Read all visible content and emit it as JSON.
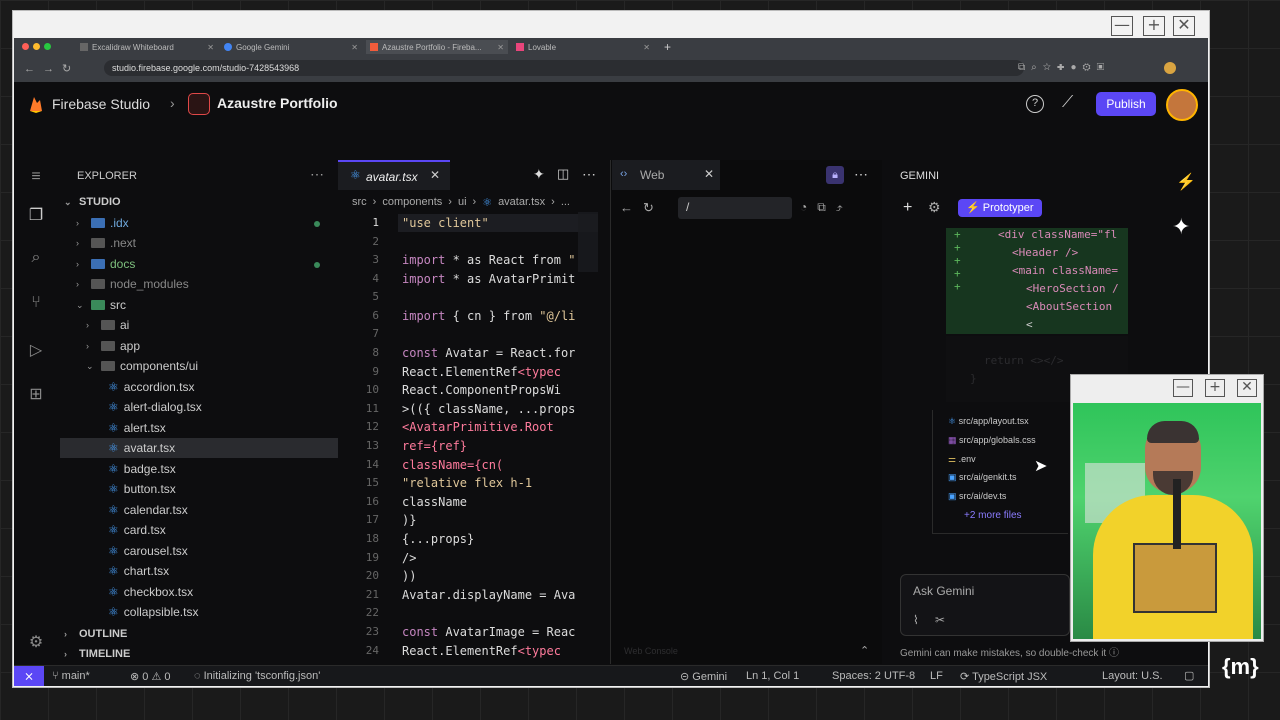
{
  "window_controls": {
    "minimize": "—",
    "maximize": "+",
    "close": "✕"
  },
  "browser": {
    "tabs": [
      {
        "label": "Excalidraw Whiteboard"
      },
      {
        "label": "Google Gemini"
      },
      {
        "label": "Azaustre Portfolio - Fireba..."
      },
      {
        "label": "Lovable"
      }
    ],
    "new_tab": "+",
    "url": "studio.firebase.google.com/studio-7428543968"
  },
  "header": {
    "brand": "Firebase Studio",
    "project": "Azaustre Portfolio",
    "publish": "Publish"
  },
  "explorer": {
    "title": "EXPLORER",
    "root": "STUDIO",
    "items": [
      ".idx",
      ".next",
      "docs",
      "node_modules",
      "src",
      "ai",
      "app",
      "components/ui",
      "accordion.tsx",
      "alert-dialog.tsx",
      "alert.tsx",
      "avatar.tsx",
      "badge.tsx",
      "button.tsx",
      "calendar.tsx",
      "card.tsx",
      "carousel.tsx",
      "chart.tsx",
      "checkbox.tsx",
      "collapsible.tsx"
    ],
    "outline": "OUTLINE",
    "timeline": "TIMELINE"
  },
  "editor": {
    "tab": "avatar.tsx",
    "breadcrumb": [
      "src",
      "components",
      "ui",
      "avatar.tsx",
      "..."
    ],
    "lines": [
      "1",
      "2",
      "3",
      "4",
      "5",
      "6",
      "7",
      "8",
      "9",
      "10",
      "11",
      "12",
      "13",
      "14",
      "15",
      "16",
      "17",
      "18",
      "19",
      "20",
      "21",
      "22",
      "23",
      "24"
    ]
  },
  "code": {
    "l1": "\"use client\"",
    "l3a": "import",
    "l3b": " * as React from ",
    "l3c": "\"",
    "l4a": "import",
    "l4b": " * as AvatarPrimit",
    "l6a": "import",
    "l6b": " { cn } from ",
    "l6c": "\"@/li",
    "l8a": "const",
    "l8b": " Avatar = React.for",
    "l9a": "  React.ElementRef",
    "l9b": "<typec",
    "l10": "  React.ComponentPropsWi",
    "l11": ">(({ className, ...props",
    "l12": "  <AvatarPrimitive.Root",
    "l13": "    ref={ref}",
    "l14": "    className={cn(",
    "l15": "      \"relative flex h-1",
    "l16": "      className",
    "l17": "    )}",
    "l18": "    {...props}",
    "l19": "  />",
    "l20": "))",
    "l21a": "Avatar.displayName = ",
    "l21b": "Ava",
    "l23a": "const",
    "l23b": " AvatarImage = Reac",
    "l24a": "  React.ElementRef",
    "l24b": "<typec"
  },
  "web": {
    "tab": "Web",
    "path": "/",
    "console": "Web Console"
  },
  "gemini": {
    "title": "Gemini",
    "mode": "Prototyper",
    "diff": [
      "<div className=\"fl",
      "<Header />",
      "<main className=",
      "<HeroSection /",
      "<AboutSection",
      "<"
    ],
    "faded": [
      "return <></>",
      "}"
    ],
    "files": [
      "src/app/layout.tsx",
      "src/app/globals.css",
      ".env",
      "src/ai/genkit.ts",
      "src/ai/dev.ts"
    ],
    "more_files": "+2 more files",
    "placeholder": "Ask Gemini",
    "disclaimer": "Gemini can make mistakes, so double-check it"
  },
  "statusbar": {
    "branch": "main*",
    "errors": "0",
    "warnings": "0",
    "task": "Initializing 'tsconfig.json'",
    "gemini": "Gemini",
    "position": "Ln 1, Col 1",
    "spaces": "Spaces: 2",
    "encoding": "UTF-8",
    "eol": "LF",
    "language": "TypeScript JSX",
    "layout": "Layout: U.S."
  },
  "watermark": "{m}",
  "colors": {
    "accent": "#5b47f5",
    "tsx": "#4aa3ff",
    "publish": "#5b47f5"
  }
}
